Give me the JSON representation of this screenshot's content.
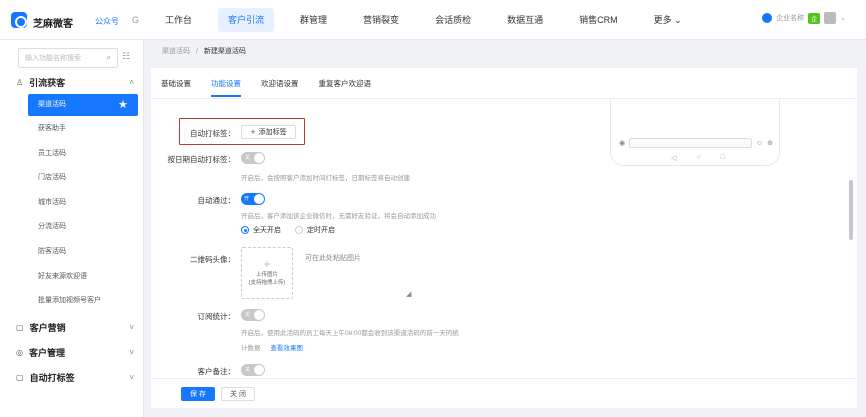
{
  "app": {
    "brand": "芝麻微客",
    "brand_sub": "公众号",
    "brand_icon": "G"
  },
  "nav": {
    "items": [
      "工作台",
      "客户引流",
      "群管理",
      "营销裂变",
      "会话质检",
      "数据互通",
      "销售CRM",
      "更多 ⌄"
    ],
    "active_index": 1
  },
  "user": {
    "badge": "企",
    "name": "企业名称"
  },
  "sidebar": {
    "search_placeholder": "输入功能名称搜索",
    "group_main": "引流获客",
    "items": [
      "渠道活码",
      "获客助手",
      "员工活码",
      "门店活码",
      "城市活码",
      "分流活码",
      "防客活码",
      "好友来源欢迎语",
      "批量添加视频号客户"
    ],
    "active_index": 0,
    "groups": [
      "客户营销",
      "客户管理",
      "自动打标签"
    ]
  },
  "breadcrumb": {
    "root": "渠道活码",
    "sep": "/",
    "current": "新建渠道活码"
  },
  "tabs": [
    "基础设置",
    "功能设置",
    "欢迎语设置",
    "重复客户欢迎语"
  ],
  "active_tab": 1,
  "form": {
    "auto_tag_label": "自动打标签：",
    "add_tag_button": "添加标签",
    "date_tag_label": "按日期自动打标签：",
    "date_tag_switch": "关",
    "date_tag_hint": "开启后，会按照客户添加时间打标签，日期标签将自动创建",
    "auto_pass_label": "自动通过：",
    "auto_pass_switch": "开",
    "auto_pass_hint": "开启后，客户添加该企业微信时，无需好友验证，将会自动添加成功",
    "radio_allday": "全天开启",
    "radio_timed": "定时开启",
    "qr_avatar_label": "二维码头像：",
    "upload_line1": "上传图片",
    "upload_line2": "(支持拖拽上传)",
    "paste_hint": "可在此处粘贴图片",
    "subscribe_label": "订阅统计：",
    "subscribe_switch": "关",
    "subscribe_hint": "开启后，使用此活码的员工每天上午08:00都会收到该渠道活码的前一天的统",
    "subscribe_hint2": "计数据",
    "view_example": "查看效果图",
    "remark_label": "客户备注：",
    "remark_switch": "关"
  },
  "footer": {
    "save": "保 存",
    "close": "关 闭"
  },
  "colors": {
    "primary": "#1677ff",
    "highlight_box": "#c0392b"
  }
}
